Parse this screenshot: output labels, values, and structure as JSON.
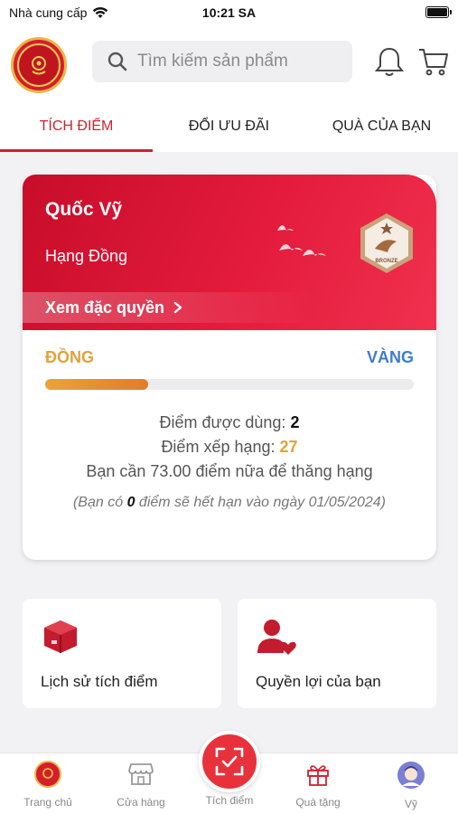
{
  "status_bar": {
    "carrier": "Nhà cung cấp",
    "time": "10:21 SA"
  },
  "header": {
    "search_placeholder": "Tìm kiếm sản phẩm"
  },
  "tabs": [
    {
      "label": "TÍCH ĐIỂM",
      "active": true
    },
    {
      "label": "ĐỔI ƯU ĐÃI",
      "active": false
    },
    {
      "label": "QUÀ CỦA BẠN",
      "active": false
    }
  ],
  "member_card": {
    "name": "Quốc Vỹ",
    "rank": "Hạng Đồng",
    "privilege_link": "Xem đặc quyền",
    "badge_text": "BRONZE",
    "level_current": "ĐỒNG",
    "level_next": "VÀNG",
    "progress_fraction": 0.28,
    "points_usable_label": "Điểm được dùng:",
    "points_usable": "2",
    "points_rank_label": "Điểm xếp hạng:",
    "points_rank": "27",
    "upgrade_message": "Bạn cần 73.00 điểm nữa để thăng hạng",
    "expire_prefix": "(Bạn có",
    "expire_points": "0",
    "expire_suffix": "điểm sẽ hết hạn vào ngày 01/05/2024)"
  },
  "tiles": [
    {
      "label": "Lịch sử tích điểm",
      "icon": "box-icon"
    },
    {
      "label": "Quyền lợi của bạn",
      "icon": "user-heart-icon"
    }
  ],
  "bottom_nav": [
    {
      "label": "Trang chủ",
      "icon": "home-logo-icon"
    },
    {
      "label": "Cửa hàng",
      "icon": "store-icon"
    },
    {
      "label": "Tích điểm",
      "icon": "scan-icon"
    },
    {
      "label": "Quà tặng",
      "icon": "gift-icon",
      "active": true
    },
    {
      "label": "Vỹ",
      "icon": "avatar-icon"
    }
  ],
  "colors": {
    "accent": "#d31f31",
    "gold": "#e2a33c",
    "blue": "#3f7bd0"
  }
}
